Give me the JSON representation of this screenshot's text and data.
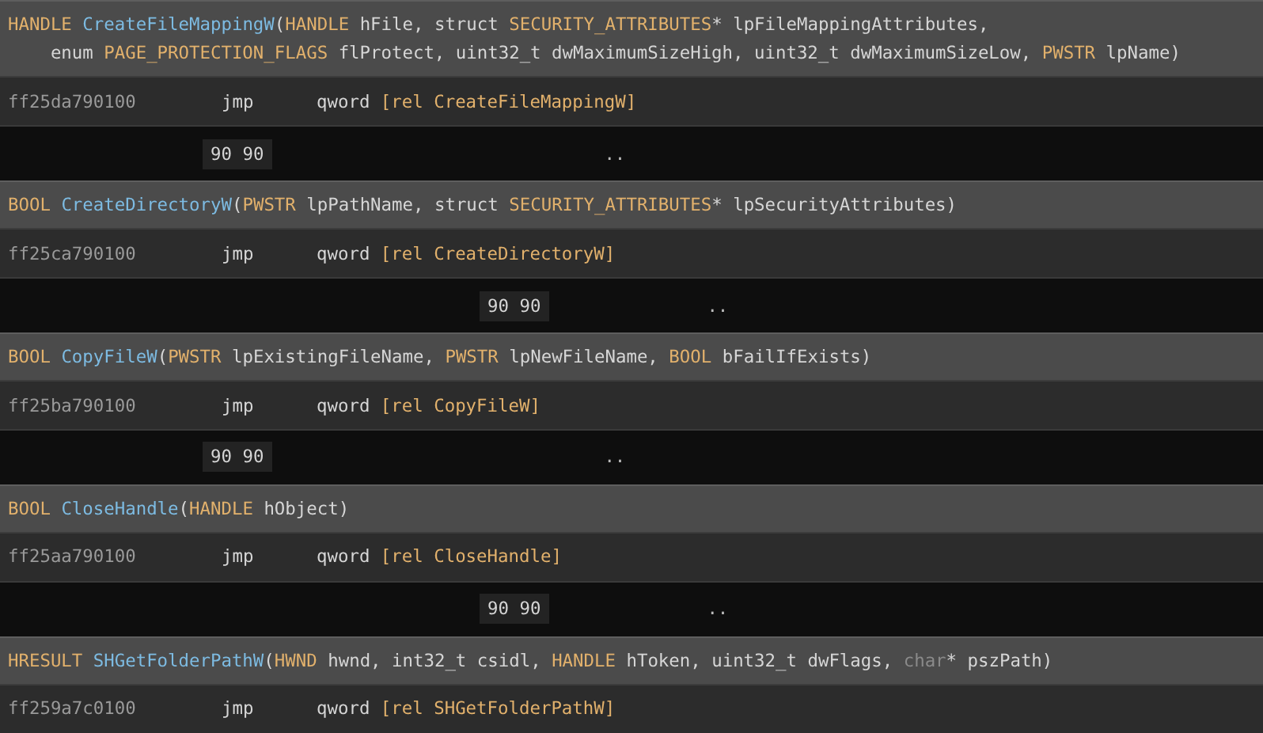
{
  "blocks": [
    {
      "signature": [
        [
          {
            "kind": "type",
            "text": "HANDLE "
          },
          {
            "kind": "name",
            "text": "CreateFileMappingW"
          },
          {
            "kind": "text",
            "text": "("
          },
          {
            "kind": "type",
            "text": "HANDLE"
          },
          {
            "kind": "text",
            "text": " hFile, struct "
          },
          {
            "kind": "type",
            "text": "SECURITY_ATTRIBUTES"
          },
          {
            "kind": "text",
            "text": "* lpFileMappingAttributes,"
          }
        ],
        [
          {
            "kind": "text",
            "text": "    enum "
          },
          {
            "kind": "type",
            "text": "PAGE_PROTECTION_FLAGS"
          },
          {
            "kind": "text",
            "text": " flProtect, uint32_t dwMaximumSizeHigh, uint32_t dwMaximumSizeLow, "
          },
          {
            "kind": "type",
            "text": "PWSTR"
          },
          {
            "kind": "text",
            "text": " lpName)"
          }
        ]
      ],
      "instruction": {
        "address": "ff25da790100",
        "mnemonic": "jmp",
        "operand": [
          {
            "kind": "text",
            "text": "qword "
          },
          {
            "kind": "type",
            "text": "[rel CreateFileMappingW]"
          }
        ]
      },
      "padding": {
        "kind": "near",
        "bytes": "90 90",
        "dots": ".."
      }
    },
    {
      "signature": [
        [
          {
            "kind": "type",
            "text": "BOOL "
          },
          {
            "kind": "name",
            "text": "CreateDirectoryW"
          },
          {
            "kind": "text",
            "text": "("
          },
          {
            "kind": "type",
            "text": "PWSTR"
          },
          {
            "kind": "text",
            "text": " lpPathName, struct "
          },
          {
            "kind": "type",
            "text": "SECURITY_ATTRIBUTES"
          },
          {
            "kind": "text",
            "text": "* lpSecurityAttributes)"
          }
        ]
      ],
      "instruction": {
        "address": "ff25ca790100",
        "mnemonic": "jmp",
        "operand": [
          {
            "kind": "text",
            "text": "qword "
          },
          {
            "kind": "type",
            "text": "[rel CreateDirectoryW]"
          }
        ]
      },
      "padding": {
        "kind": "far",
        "bytes": "90 90",
        "dots": ".."
      }
    },
    {
      "signature": [
        [
          {
            "kind": "type",
            "text": "BOOL "
          },
          {
            "kind": "name",
            "text": "CopyFileW"
          },
          {
            "kind": "text",
            "text": "("
          },
          {
            "kind": "type",
            "text": "PWSTR"
          },
          {
            "kind": "text",
            "text": " lpExistingFileName, "
          },
          {
            "kind": "type",
            "text": "PWSTR"
          },
          {
            "kind": "text",
            "text": " lpNewFileName, "
          },
          {
            "kind": "type",
            "text": "BOOL"
          },
          {
            "kind": "text",
            "text": " bFailIfExists)"
          }
        ]
      ],
      "instruction": {
        "address": "ff25ba790100",
        "mnemonic": "jmp",
        "operand": [
          {
            "kind": "text",
            "text": "qword "
          },
          {
            "kind": "type",
            "text": "[rel CopyFileW]"
          }
        ]
      },
      "padding": {
        "kind": "near",
        "bytes": "90 90",
        "dots": ".."
      }
    },
    {
      "signature": [
        [
          {
            "kind": "type",
            "text": "BOOL "
          },
          {
            "kind": "name",
            "text": "CloseHandle"
          },
          {
            "kind": "text",
            "text": "("
          },
          {
            "kind": "type",
            "text": "HANDLE"
          },
          {
            "kind": "text",
            "text": " hObject)"
          }
        ]
      ],
      "instruction": {
        "address": "ff25aa790100",
        "mnemonic": "jmp",
        "operand": [
          {
            "kind": "text",
            "text": "qword "
          },
          {
            "kind": "type",
            "text": "[rel CloseHandle]"
          }
        ]
      },
      "padding": {
        "kind": "far",
        "bytes": "90 90",
        "dots": ".."
      }
    },
    {
      "signature": [
        [
          {
            "kind": "type",
            "text": "HRESULT "
          },
          {
            "kind": "name",
            "text": "SHGetFolderPathW"
          },
          {
            "kind": "text",
            "text": "("
          },
          {
            "kind": "type",
            "text": "HWND"
          },
          {
            "kind": "text",
            "text": " hwnd, int32_t csidl, "
          },
          {
            "kind": "type",
            "text": "HANDLE"
          },
          {
            "kind": "text",
            "text": " hToken, uint32_t dwFlags, "
          },
          {
            "kind": "dim",
            "text": "char"
          },
          {
            "kind": "text",
            "text": "* pszPath)"
          }
        ]
      ],
      "instruction": {
        "address": "ff259a7c0100",
        "mnemonic": "jmp",
        "operand": [
          {
            "kind": "text",
            "text": "qword "
          },
          {
            "kind": "type",
            "text": "[rel SHGetFolderPathW]"
          }
        ]
      }
    }
  ]
}
